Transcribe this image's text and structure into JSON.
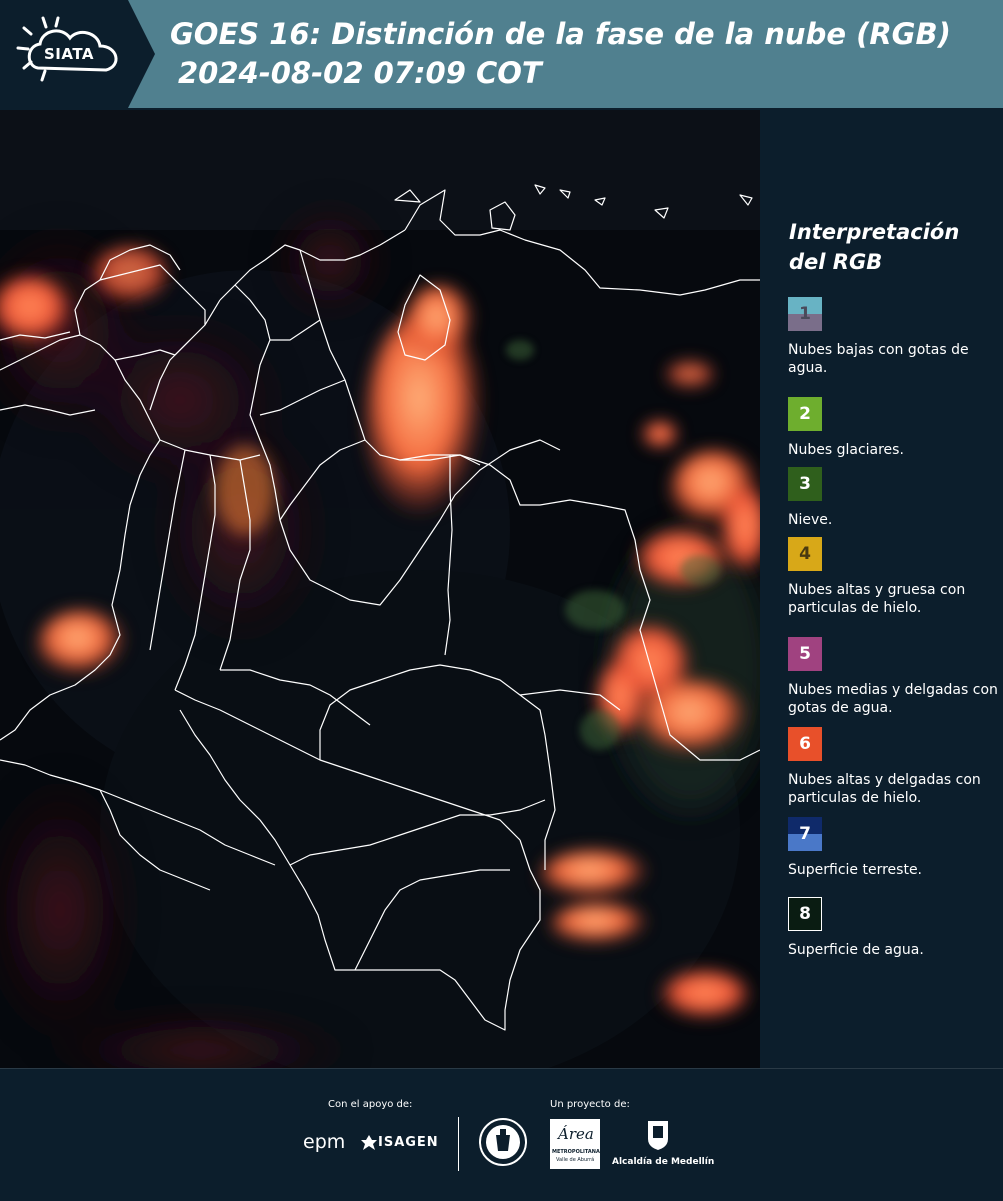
{
  "header": {
    "logo_text": "SIATA",
    "title": "GOES 16: Distinción de la fase de la nube (RGB)",
    "subtitle": "2024-08-02 07:09 COT"
  },
  "legend": {
    "title": "Interpretación del RGB",
    "items": [
      {
        "number": "1",
        "text": "Nubes bajas con gotas de agua.",
        "color_top": "#68b3c4",
        "color_bottom": "#7a6e8a",
        "num_color": "#4a4a5a"
      },
      {
        "number": "2",
        "text": "Nubes glaciares.",
        "color_top": "#6eae2e",
        "color_bottom": "#6eae2e",
        "num_color": "#ffffff"
      },
      {
        "number": "3",
        "text": "Nieve.",
        "color_top": "#2f5f1c",
        "color_bottom": "#2f5f1c",
        "num_color": "#ffffff"
      },
      {
        "number": "4",
        "text": "Nubes altas y gruesa con particulas de hielo.",
        "color_top": "#d8a818",
        "color_bottom": "#d8a818",
        "num_color": "#4a3a10"
      },
      {
        "number": "5",
        "text": "Nubes medias y delgadas con gotas de agua.",
        "color_top": "#a04280",
        "color_bottom": "#a04280",
        "num_color": "#ffffff"
      },
      {
        "number": "6",
        "text": "Nubes altas y delgadas con particulas de hielo.",
        "color_top": "#e8502a",
        "color_bottom": "#e8502a",
        "num_color": "#ffffff"
      },
      {
        "number": "7",
        "text": "Superficie terreste.",
        "color_top": "#0f2a6a",
        "color_bottom": "#4a78c8",
        "num_color": "#ffffff"
      },
      {
        "number": "8",
        "text": "Superficie de agua.",
        "color_top": "#0a1c12",
        "color_bottom": "#0a1c12",
        "num_color": "#ffffff"
      }
    ]
  },
  "footer": {
    "support_label": "Con el apoyo de:",
    "project_label": "Un proyecto de:",
    "epm_text": "epm",
    "isagen_text": "ISAGEN",
    "area_text": "Área",
    "area_sub1": "METROPOLITANA",
    "area_sub2": "Valle de Aburrá",
    "alcaldia_text": "Alcaldía de Medellín"
  }
}
